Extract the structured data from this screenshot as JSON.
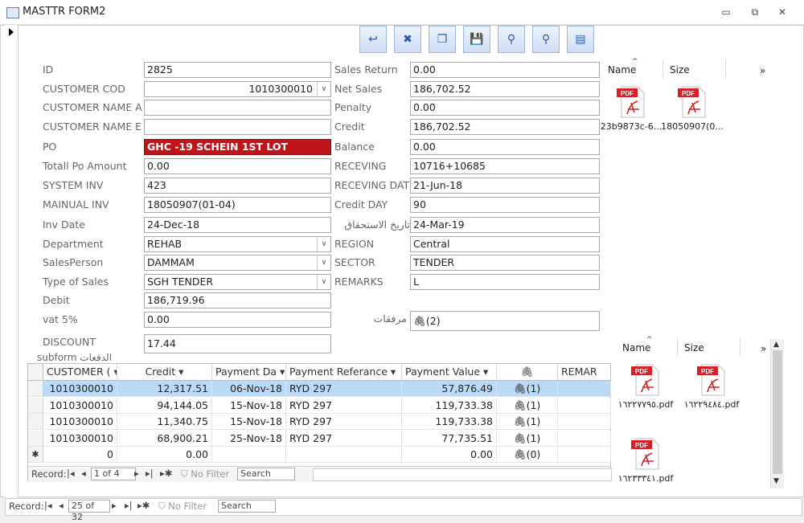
{
  "window": {
    "title": "MASTTR FORM2",
    "minimize": "▭",
    "restore": "⧉",
    "close": "✕"
  },
  "toolbar": {
    "buttons": [
      {
        "name": "exit-icon",
        "glyph": "↩"
      },
      {
        "name": "delete-record-icon",
        "glyph": "✖"
      },
      {
        "name": "copy-icon",
        "glyph": "❐"
      },
      {
        "name": "save-icon",
        "glyph": "💾"
      },
      {
        "name": "find-user-icon",
        "glyph": "⚲"
      },
      {
        "name": "search-icon",
        "glyph": "⚲"
      },
      {
        "name": "print-icon",
        "glyph": "▤"
      }
    ]
  },
  "left_fields": [
    {
      "label": "ID",
      "value": "2825"
    },
    {
      "label": "CUSTOMER COD",
      "value": "1010300010",
      "dropdown": true,
      "align": "right"
    },
    {
      "label": "CUSTOMER NAME AF",
      "value": ""
    },
    {
      "label": "CUSTOMER NAME EN",
      "value": ""
    },
    {
      "label": "PO",
      "value": "GHC -19 SCHEIN 1ST LOT",
      "highlight": true
    },
    {
      "label": "Totall Po Amount",
      "value": "0.00"
    },
    {
      "label": "SYSTEM INV",
      "value": "423"
    },
    {
      "label": "MAINUAL INV",
      "value": "18050907(01-04)"
    },
    {
      "label": "Inv Date",
      "value": "24-Dec-18"
    },
    {
      "label": "Department",
      "value": "REHAB",
      "dropdown": true
    },
    {
      "label": "SalesPerson",
      "value": "DAMMAM",
      "dropdown": true
    },
    {
      "label": "Type of Sales",
      "value": "SGH TENDER",
      "dropdown": true
    },
    {
      "label": "Debit",
      "value": "186,719.96"
    },
    {
      "label": "vat 5%",
      "value": "0.00"
    },
    {
      "label": "DISCOUNT",
      "value": "17.44"
    }
  ],
  "right_fields": [
    {
      "label": "Sales Return",
      "value": "0.00"
    },
    {
      "label": "Net Sales",
      "value": "186,702.52"
    },
    {
      "label": "Penalty",
      "value": "0.00"
    },
    {
      "label": "Credit",
      "value": "186,702.52"
    },
    {
      "label": "Balance",
      "value": "0.00"
    },
    {
      "label": "RECEVING",
      "value": "10716+10685"
    },
    {
      "label": "RECEVING DATE",
      "value": "21-Jun-18"
    },
    {
      "label": "Credit DAY",
      "value": "90"
    },
    {
      "label": "تاريخ الاستحقاق",
      "value": "24-Mar-19"
    },
    {
      "label": "REGION",
      "value": "Central"
    },
    {
      "label": "SECTOR",
      "value": "TENDER"
    },
    {
      "label": "REMARKS",
      "value": "L"
    }
  ],
  "attachments_field": {
    "label": "مرفقات",
    "value": "(2)"
  },
  "attachments_top": {
    "col_name": "Name",
    "col_size": "Size",
    "more": "»",
    "files": [
      {
        "name": "23b9873c-6..."
      },
      {
        "name": "18050907(0..."
      }
    ]
  },
  "attachments_bottom": {
    "col_name": "Name",
    "col_size": "Size",
    "more": "»",
    "files": [
      {
        "name": "١٦٢٢٧٧٩٥.pdf"
      },
      {
        "name": "١٦٢٢٩٤٨٤.pdf"
      },
      {
        "name": "١٦٢٣٣٣٤١.pdf"
      }
    ]
  },
  "pdf_badge": "PDF",
  "subform": {
    "label": "subform الدفعات",
    "columns": [
      "CUSTOMER (",
      "Credit",
      "Payment Da",
      "Payment Referance",
      "Payment Value",
      "REMAR"
    ],
    "rows": [
      {
        "customer": "1010300010",
        "credit": "12,317.51",
        "date": "06-Nov-18",
        "ref": "RYD 297",
        "value": "57,876.49",
        "att": "(1)",
        "selected": true
      },
      {
        "customer": "1010300010",
        "credit": "94,144.05",
        "date": "15-Nov-18",
        "ref": "RYD 297",
        "value": "119,733.38",
        "att": "(1)"
      },
      {
        "customer": "1010300010",
        "credit": "11,340.75",
        "date": "15-Nov-18",
        "ref": "RYD 297",
        "value": "119,733.38",
        "att": "(1)"
      },
      {
        "customer": "1010300010",
        "credit": "68,900.21",
        "date": "25-Nov-18",
        "ref": "RYD 297",
        "value": "77,735.51",
        "att": "(1)"
      }
    ],
    "new_row": {
      "customer": "0",
      "credit": "0.00",
      "value": "0.00",
      "att": "(0)"
    },
    "nav": {
      "record": "Record:",
      "position": "1 of 4",
      "no_filter": "No Filter",
      "search": "Search"
    }
  },
  "main_nav": {
    "record": "Record:",
    "position": "25 of 32",
    "no_filter": "No Filter",
    "search": "Search"
  },
  "colors": {
    "accent": "#9bb7e3",
    "highlight": "#c0141b",
    "selected_row": "#bcd9f5"
  }
}
